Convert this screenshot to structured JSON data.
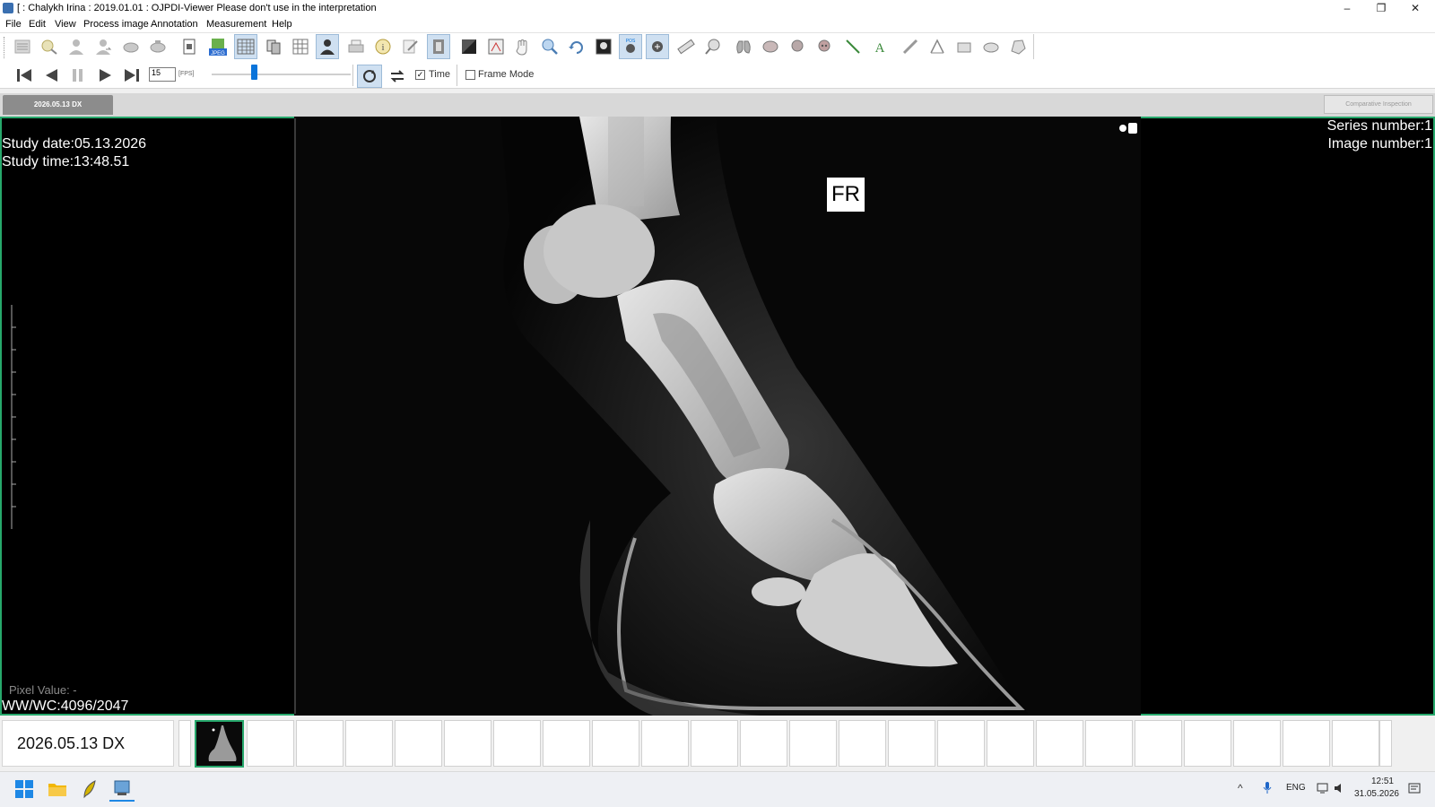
{
  "window": {
    "title": "[ : Chalykh Irina : 2019.01.01 : OJPDI-Viewer  Please don't use in the interpretation",
    "min_glyph": "–",
    "max_glyph": "❐",
    "close_glyph": "✕"
  },
  "menu": [
    "File",
    "Edit",
    "View",
    "Process image",
    "Annotation",
    "Measurement",
    "Help"
  ],
  "toolbar": {
    "jpeg_badge": "JPEG",
    "pos_badge": "POS",
    "accent": "#0a74da"
  },
  "playback": {
    "fps_value": "15",
    "fps_label": "[FPS]",
    "speed_level": 0.3,
    "time_checked": "✓",
    "time_label": "Time",
    "frame_mode_label": "Frame Mode"
  },
  "tabs": {
    "study_tab": "2026.05.13 DX",
    "compare_button": "Comparative Inspection"
  },
  "overlay": {
    "study_date": "Study date:05.13.2026",
    "study_time": "Study time:13:48.51",
    "series_number": "Series number:1",
    "image_number": "Image number:1",
    "marker": "FR",
    "pixel_value": "Pixel Value:  -",
    "ww_wc": "WW/WC:4096/2047"
  },
  "thumbnails": {
    "series_label": "2026.05.13 DX",
    "empty_slots": 23,
    "active_border": "#27a86c"
  },
  "taskbar": {
    "lang": "ENG",
    "time": "12:51",
    "date": "31.05.2026"
  }
}
